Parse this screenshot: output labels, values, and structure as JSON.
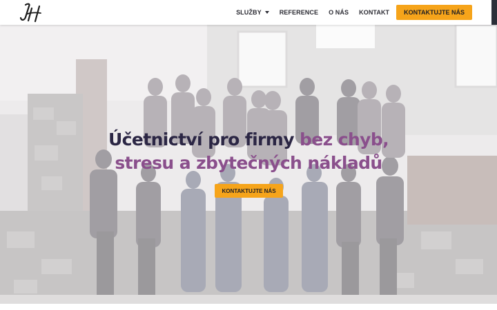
{
  "logo": {
    "icon": "jh-monogram-logo"
  },
  "nav": {
    "items": [
      {
        "label": "SLUŽBY",
        "has_dropdown": true
      },
      {
        "label": "REFERENCE"
      },
      {
        "label": "O NÁS"
      },
      {
        "label": "KONTAKT"
      }
    ],
    "cta_label": "KONTAKTUJTE NÁS"
  },
  "hero": {
    "headline_part1": "Účetnictví pro firmy ",
    "headline_part2": "bez chyb,",
    "headline_part3": "stresu a zbytečných nákladů",
    "cta_label": "KONTAKTUJTE NÁS",
    "image_subject": "team-group-photo"
  },
  "colors": {
    "accent_orange": "#f6a41a",
    "headline_dark": "#2b2644",
    "headline_purple": "#8a4f8c",
    "nav_text": "#2b2b33"
  }
}
